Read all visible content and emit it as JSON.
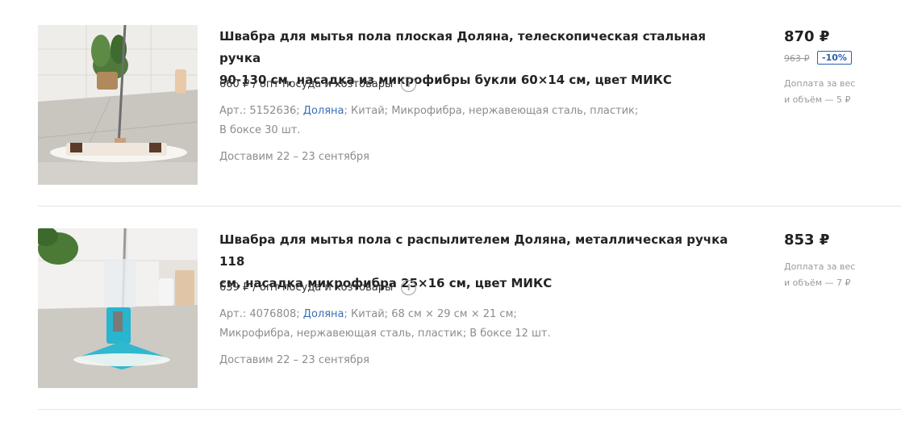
{
  "products": [
    {
      "title_line1": "Швабра для мытья пола плоская Доляна, телескопическая стальная ручка",
      "title_line2": "90-130 см, насадка из микрофибры букли 60×14 см, цвет МИКС",
      "wholesale": "660 ₽ / опт посуда и хозтовары",
      "info_icon": "i",
      "attrs_line1_prefix": "Арт.: 5152636;",
      "brand": "Доляна",
      "attrs_line1_suffix": ";  Китай;  Микрофибра, нержавеющая сталь, пластик;",
      "attrs_line2": "В боксе 30 шт.",
      "delivery": "Доставим 22 – 23 сентября",
      "price": "870 ₽",
      "old_price": "963 ₽",
      "discount": "-10%",
      "surcharge_line1": "Доплата за вес",
      "surcharge_line2": "и объём — 5 ₽",
      "image_icon": "flat-mop-photo"
    },
    {
      "title_line1": "Швабра для мытья пола с распылителем Доляна, металлическая ручка 118",
      "title_line2": "см, насадка микрофибра 25×16 см, цвет МИКС",
      "wholesale": "639 ₽ / опт посуда и хозтовары",
      "info_icon": "i",
      "attrs_line1_prefix": "Арт.: 4076808;",
      "brand": "Доляна",
      "attrs_line1_suffix": ";  Китай;  68 см × 29 см × 21 см;",
      "attrs_line2": "Микрофибра, нержавеющая сталь, пластик;  В боксе 12 шт.",
      "delivery": "Доставим 22 – 23 сентября",
      "price": "853 ₽",
      "surcharge_line1": "Доплата за вес",
      "surcharge_line2": "и объём — 7 ₽",
      "image_icon": "spray-mop-photo"
    }
  ],
  "colors": {
    "brand_link": "#3a6fb8",
    "discount": "#2b5fb0",
    "muted_text": "#8c8c8c"
  }
}
